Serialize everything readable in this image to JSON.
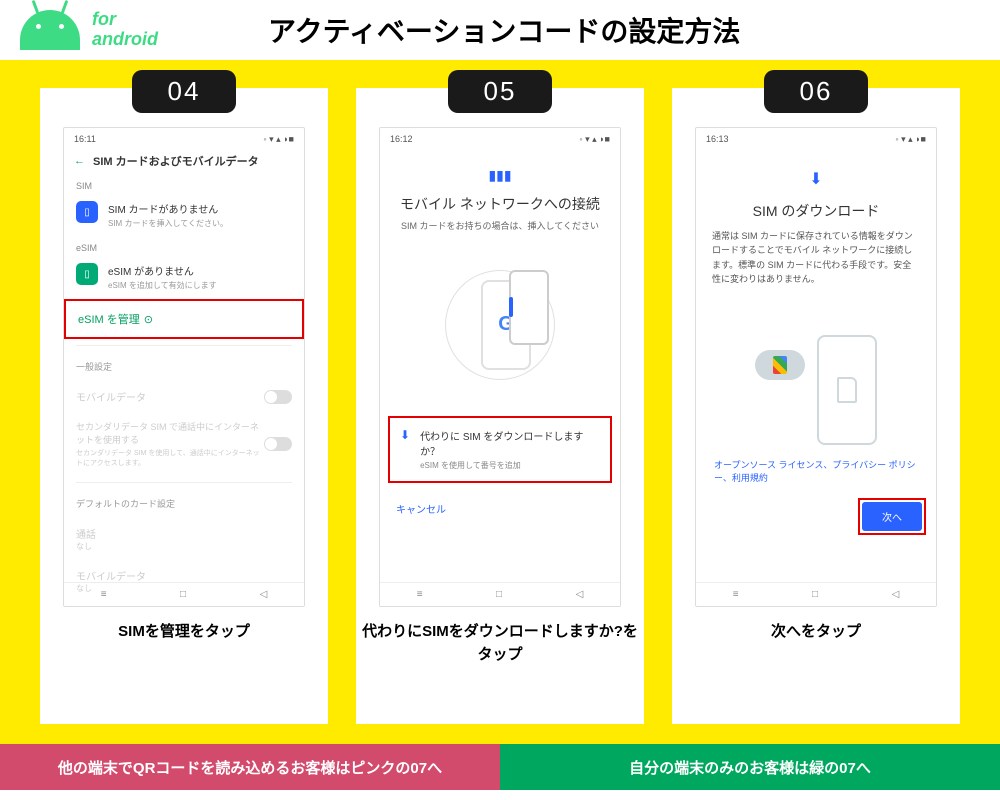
{
  "header": {
    "for_label": "for",
    "android_label": "android",
    "title": "アクティベーションコードの設定方法"
  },
  "steps": [
    {
      "num": "04",
      "phone": {
        "time": "16:11",
        "screen_title": "SIM カードおよびモバイルデータ",
        "section_sim": "SIM",
        "no_sim_title": "SIM カードがありません",
        "no_sim_sub": "SIM カードを挿入してください。",
        "section_esim": "eSIM",
        "no_esim_title": "eSIM がありません",
        "no_esim_sub": "eSIM を追加して有効にします",
        "manage_esim": "eSIM を管理",
        "general": "一般設定",
        "mobile_data": "モバイルデータ",
        "secondary_title": "セカンダリデータ SIM で通話中にインターネットを使用する",
        "secondary_sub": "セカンダリデータ SIM を使用して、通話中にインターネットにアクセスします。",
        "default_cards": "デフォルトのカード設定",
        "call": "通話",
        "none1": "なし",
        "mobile_data2": "モバイルデータ",
        "none2": "なし"
      },
      "caption": "SIMを管理をタップ"
    },
    {
      "num": "05",
      "phone": {
        "time": "16:12",
        "title": "モバイル ネットワークへの接続",
        "sub": "SIM カードをお持ちの場合は、挿入してください",
        "dl_title": "代わりに SIM をダウンロードしますか？",
        "dl_sub": "eSIM を使用して番号を追加",
        "cancel": "キャンセル"
      },
      "caption": "代わりにSIMをダウンロードしますか?をタップ"
    },
    {
      "num": "06",
      "phone": {
        "time": "16:13",
        "title": "SIM のダウンロード",
        "desc": "通常は SIM カードに保存されている情報をダウンロードすることでモバイル ネットワークに接続します。標準の SIM カードに代わる手段です。安全性に変わりはありません。",
        "links": "オープンソース ライセンス、プライバシー ポリシー、利用規約",
        "next": "次へ"
      },
      "caption": "次へをタップ"
    }
  ],
  "footer": {
    "pink": "他の端末でQRコードを読み込めるお客様はピンクの07へ",
    "green": "自分の端末のみのお客様は緑の07へ"
  }
}
